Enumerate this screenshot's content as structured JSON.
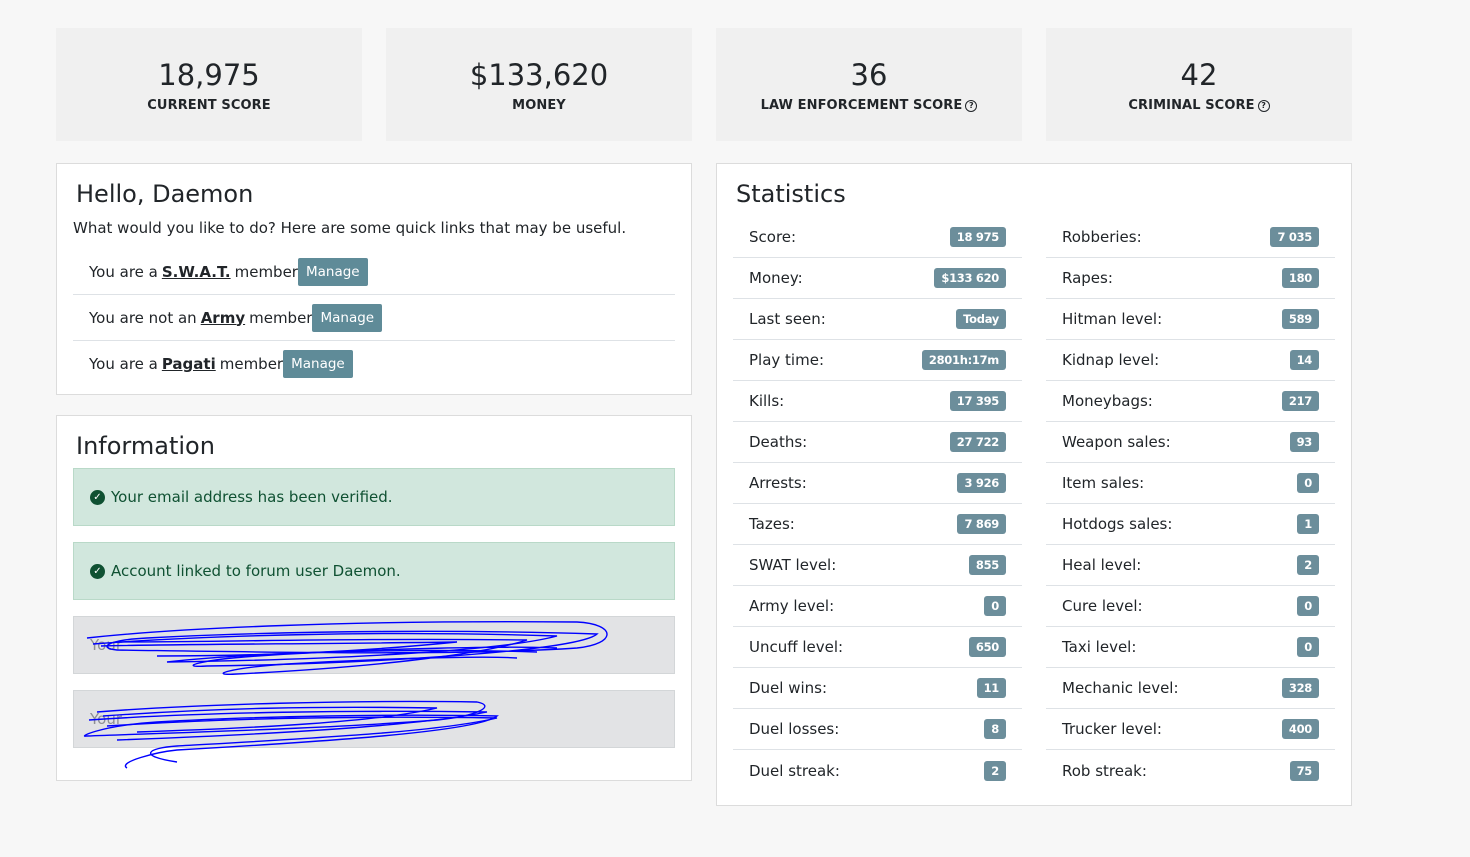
{
  "score_cards": [
    {
      "value": "18,975",
      "label": "CURRENT SCORE",
      "help": false
    },
    {
      "value": "$133,620",
      "label": "MONEY",
      "help": false
    },
    {
      "value": "36",
      "label": "LAW ENFORCEMENT SCORE",
      "help": true
    },
    {
      "value": "42",
      "label": "CRIMINAL SCORE",
      "help": true
    }
  ],
  "hello": {
    "title": "Hello, Daemon",
    "intro": "What would you like to do? Here are some quick links that may be useful.",
    "groups": [
      {
        "prefix": "You are a",
        "name": "S.W.A.T.",
        "suffix": "member",
        "button": "Manage"
      },
      {
        "prefix": "You are not an",
        "name": "Army",
        "suffix": "member",
        "button": "Manage"
      },
      {
        "prefix": "You are a",
        "name": "Pagati",
        "suffix": "member",
        "button": "Manage"
      }
    ]
  },
  "information": {
    "title": "Information",
    "alerts": [
      {
        "text": "Your email address has been verified.",
        "type": "success"
      },
      {
        "text": "Account linked to forum user Daemon.",
        "type": "success"
      },
      {
        "text": "Your",
        "type": "redacted"
      },
      {
        "text": "Your",
        "type": "redacted"
      }
    ]
  },
  "statistics": {
    "title": "Statistics",
    "left": [
      {
        "label": "Score:",
        "value": "18 975"
      },
      {
        "label": "Money:",
        "value": "$133 620"
      },
      {
        "label": "Last seen:",
        "value": "Today"
      },
      {
        "label": "Play time:",
        "value": "2801h:17m"
      },
      {
        "label": "Kills:",
        "value": "17 395"
      },
      {
        "label": "Deaths:",
        "value": "27 722"
      },
      {
        "label": "Arrests:",
        "value": "3 926"
      },
      {
        "label": "Tazes:",
        "value": "7 869"
      },
      {
        "label": "SWAT level:",
        "value": "855"
      },
      {
        "label": "Army level:",
        "value": "0"
      },
      {
        "label": "Uncuff level:",
        "value": "650"
      },
      {
        "label": "Duel wins:",
        "value": "11"
      },
      {
        "label": "Duel losses:",
        "value": "8"
      },
      {
        "label": "Duel streak:",
        "value": "2"
      }
    ],
    "right": [
      {
        "label": "Robberies:",
        "value": "7 035"
      },
      {
        "label": "Rapes:",
        "value": "180"
      },
      {
        "label": "Hitman level:",
        "value": "589"
      },
      {
        "label": "Kidnap level:",
        "value": "14"
      },
      {
        "label": "Moneybags:",
        "value": "217"
      },
      {
        "label": "Weapon sales:",
        "value": "93"
      },
      {
        "label": "Item sales:",
        "value": "0"
      },
      {
        "label": "Hotdogs sales:",
        "value": "1"
      },
      {
        "label": "Heal level:",
        "value": "2"
      },
      {
        "label": "Cure level:",
        "value": "0"
      },
      {
        "label": "Taxi level:",
        "value": "0"
      },
      {
        "label": "Mechanic level:",
        "value": "328"
      },
      {
        "label": "Trucker level:",
        "value": "400"
      },
      {
        "label": "Rob streak:",
        "value": "75"
      }
    ]
  },
  "icons": {
    "help": "question-circle-icon",
    "check": "check-circle-icon"
  },
  "colors": {
    "badge": "#6c8e9b",
    "manage_button": "#5f8b98",
    "success_bg": "#d1e7dd",
    "success_text": "#0f5132",
    "scribble": "#0000ff"
  }
}
